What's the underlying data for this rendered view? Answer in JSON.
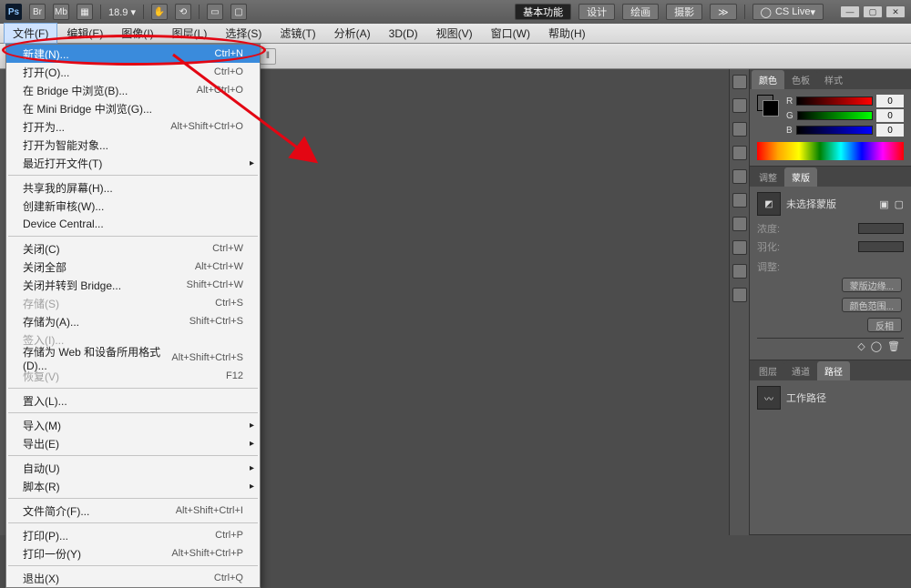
{
  "titlebar": {
    "logo": "Ps",
    "zoom": "18.9",
    "basic": "基本功能",
    "design": "设计",
    "paint": "绘画",
    "photo": "摄影",
    "cslive": "CS Live"
  },
  "menubar": {
    "items": [
      "文件(F)",
      "编辑(E)",
      "图像(I)",
      "图层(L)",
      "选择(S)",
      "滤镜(T)",
      "分析(A)",
      "3D(D)",
      "视图(V)",
      "窗口(W)",
      "帮助(H)"
    ]
  },
  "dropdown": {
    "items": [
      {
        "label": "新建(N)...",
        "shortcut": "Ctrl+N",
        "hl": true
      },
      {
        "label": "打开(O)...",
        "shortcut": "Ctrl+O"
      },
      {
        "label": "在 Bridge 中浏览(B)...",
        "shortcut": "Alt+Ctrl+O"
      },
      {
        "label": "在 Mini Bridge 中浏览(G)..."
      },
      {
        "label": "打开为...",
        "shortcut": "Alt+Shift+Ctrl+O"
      },
      {
        "label": "打开为智能对象..."
      },
      {
        "label": "最近打开文件(T)",
        "sub": true
      },
      {
        "sep": true
      },
      {
        "label": "共享我的屏幕(H)..."
      },
      {
        "label": "创建新审核(W)..."
      },
      {
        "label": "Device Central..."
      },
      {
        "sep": true
      },
      {
        "label": "关闭(C)",
        "shortcut": "Ctrl+W"
      },
      {
        "label": "关闭全部",
        "shortcut": "Alt+Ctrl+W"
      },
      {
        "label": "关闭并转到 Bridge...",
        "shortcut": "Shift+Ctrl+W"
      },
      {
        "label": "存储(S)",
        "shortcut": "Ctrl+S",
        "dis": true
      },
      {
        "label": "存储为(A)...",
        "shortcut": "Shift+Ctrl+S"
      },
      {
        "label": "签入(I)...",
        "dis": true
      },
      {
        "label": "存储为 Web 和设备所用格式(D)...",
        "shortcut": "Alt+Shift+Ctrl+S"
      },
      {
        "label": "恢复(V)",
        "shortcut": "F12",
        "dis": true
      },
      {
        "sep": true
      },
      {
        "label": "置入(L)..."
      },
      {
        "sep": true
      },
      {
        "label": "导入(M)",
        "sub": true
      },
      {
        "label": "导出(E)",
        "sub": true
      },
      {
        "sep": true
      },
      {
        "label": "自动(U)",
        "sub": true
      },
      {
        "label": "脚本(R)",
        "sub": true
      },
      {
        "sep": true
      },
      {
        "label": "文件简介(F)...",
        "shortcut": "Alt+Shift+Ctrl+I"
      },
      {
        "sep": true
      },
      {
        "label": "打印(P)...",
        "shortcut": "Ctrl+P"
      },
      {
        "label": "打印一份(Y)",
        "shortcut": "Alt+Shift+Ctrl+P"
      },
      {
        "sep": true
      },
      {
        "label": "退出(X)",
        "shortcut": "Ctrl+Q"
      }
    ]
  },
  "panels": {
    "color": {
      "tabs": [
        "颜色",
        "色板",
        "样式"
      ],
      "channels": [
        "R",
        "G",
        "B"
      ],
      "val": "0",
      "swatch_fg": "#000000",
      "swatch_bg": "#ffffff"
    },
    "adjust": {
      "tabs": [
        "调整",
        "蒙版"
      ],
      "mask_label": "未选择蒙版",
      "density": "浓度:",
      "feather": "羽化:",
      "opts": "调整:",
      "b1": "蒙版边缘...",
      "b2": "颜色范围...",
      "b3": "反相"
    },
    "paths": {
      "tabs": [
        "图层",
        "通道",
        "路径"
      ],
      "item": "工作路径"
    }
  }
}
